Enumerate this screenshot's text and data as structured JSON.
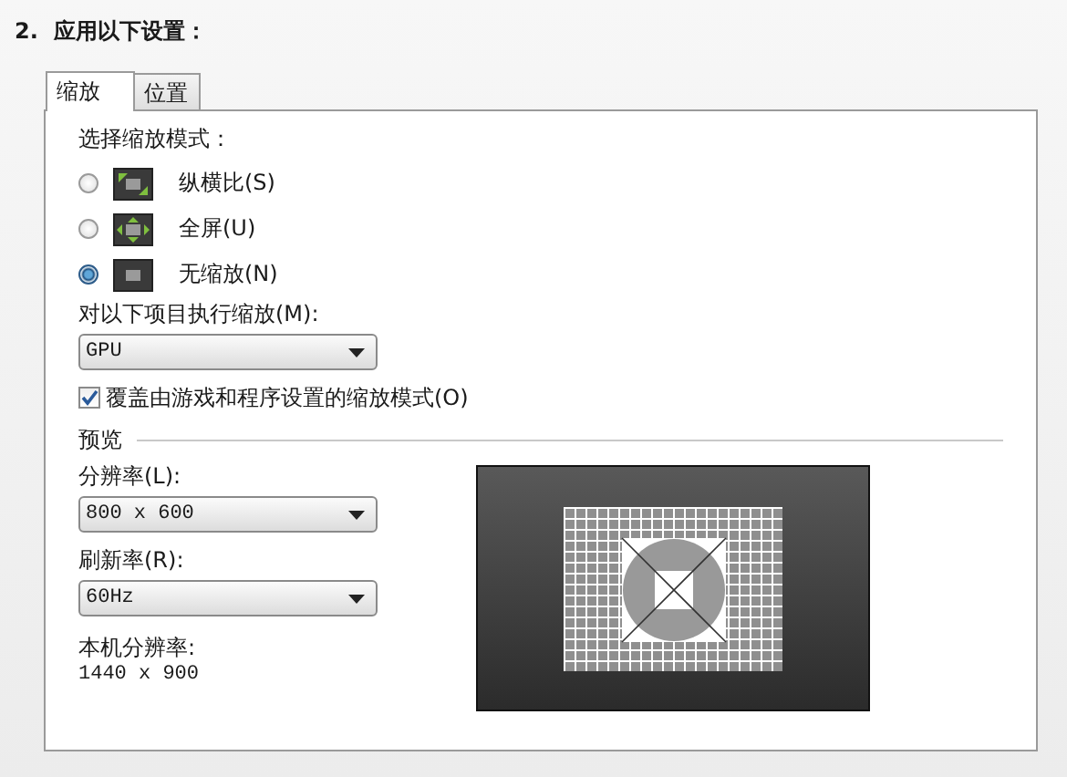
{
  "heading": "2.  应用以下设置：",
  "tabs": [
    {
      "label": "缩放",
      "selected": true
    },
    {
      "label": "位置",
      "selected": false
    }
  ],
  "scaling_mode": {
    "label": "选择缩放模式：",
    "options": [
      {
        "label": "纵横比(S)",
        "selected": false,
        "kind": "aspect"
      },
      {
        "label": "全屏(U)",
        "selected": false,
        "kind": "fullscreen"
      },
      {
        "label": "无缩放(N)",
        "selected": true,
        "kind": "none"
      }
    ]
  },
  "perform_on": {
    "label": "对以下项目执行缩放(M):",
    "value": "GPU"
  },
  "override": {
    "label": "覆盖由游戏和程序设置的缩放模式(O)",
    "checked": true
  },
  "preview": {
    "title": "预览",
    "resolution": {
      "label": "分辨率(L):",
      "value": "800 x 600"
    },
    "refresh": {
      "label": "刷新率(R):",
      "value": "60Hz"
    },
    "native": {
      "label": "本机分辨率:",
      "value": "1440 x 900"
    }
  }
}
